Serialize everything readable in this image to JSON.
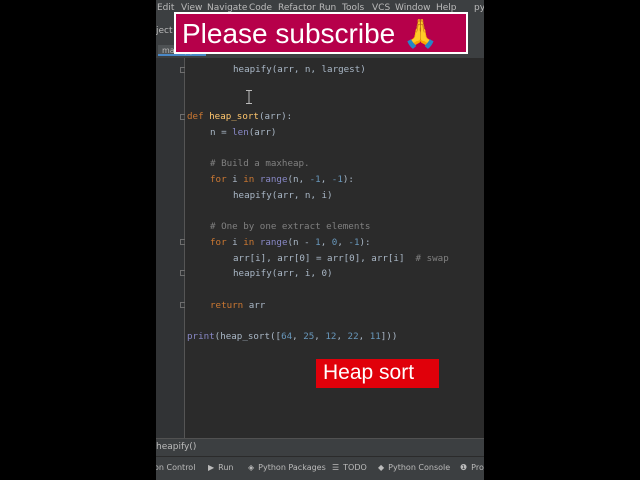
{
  "menu": [
    "Edit",
    "View",
    "Navigate",
    "Code",
    "Refactor",
    "Run",
    "Tools",
    "VCS",
    "Window",
    "Help",
    "py"
  ],
  "project_fragment": "ject",
  "tab_fragment": "main.py",
  "code": {
    "l1": "heapify(arr, n, largest)",
    "def_kw": "def ",
    "def_name": "heap_sort",
    "def_rest": "(arr):",
    "n_assign": "n = ",
    "len_fn": "len",
    "len_rest": "(arr)",
    "comment1": "# Build a maxheap.",
    "for1_kw": "for ",
    "for1_var": "i ",
    "for1_in": "in ",
    "for1_range": "range",
    "for1_open": "(n, ",
    "for1_n1": "-1",
    "for1_c": ", ",
    "for1_n2": "-1",
    "for1_close": "):",
    "heapify2": "heapify(arr, n, i)",
    "comment2": "# One by one extract elements",
    "for2_kw": "for ",
    "for2_var": "i ",
    "for2_in": "in ",
    "for2_range": "range",
    "for2_open": "(n - ",
    "for2_n1": "1",
    "for2_c1": ", ",
    "for2_n2": "0",
    "for2_c2": ", ",
    "for2_n3": "-1",
    "for2_close": "):",
    "swap_code": "arr[i], arr[0] = arr[0], arr[i]  ",
    "swap_comment": "# swap",
    "heapify3": "heapify(arr, i, 0)",
    "return_kw": "return ",
    "return_val": "arr",
    "print_fn": "print",
    "print_open": "(heap_sort([",
    "v1": "64",
    "sep1": ", ",
    "v2": "25",
    "sep2": ", ",
    "v3": "12",
    "sep3": ", ",
    "v4": "22",
    "sep4": ", ",
    "v5": "11",
    "print_close": "]))"
  },
  "breadcrumb": "heapify()",
  "toolbar": {
    "version_control": "on Control",
    "run": "Run",
    "python_packages": "Python Packages",
    "todo": "TODO",
    "python_console": "Python Console",
    "problems": "Pro"
  },
  "overlay": {
    "subscribe": "Please subscribe 🙏",
    "heap_sort": "Heap sort"
  },
  "colors": {
    "banner_bg": "#b6004a",
    "heap_label_bg": "#e0000a",
    "keyword": "#cc7832",
    "function": "#ffc66d",
    "number": "#6897bb",
    "comment": "#808080"
  }
}
